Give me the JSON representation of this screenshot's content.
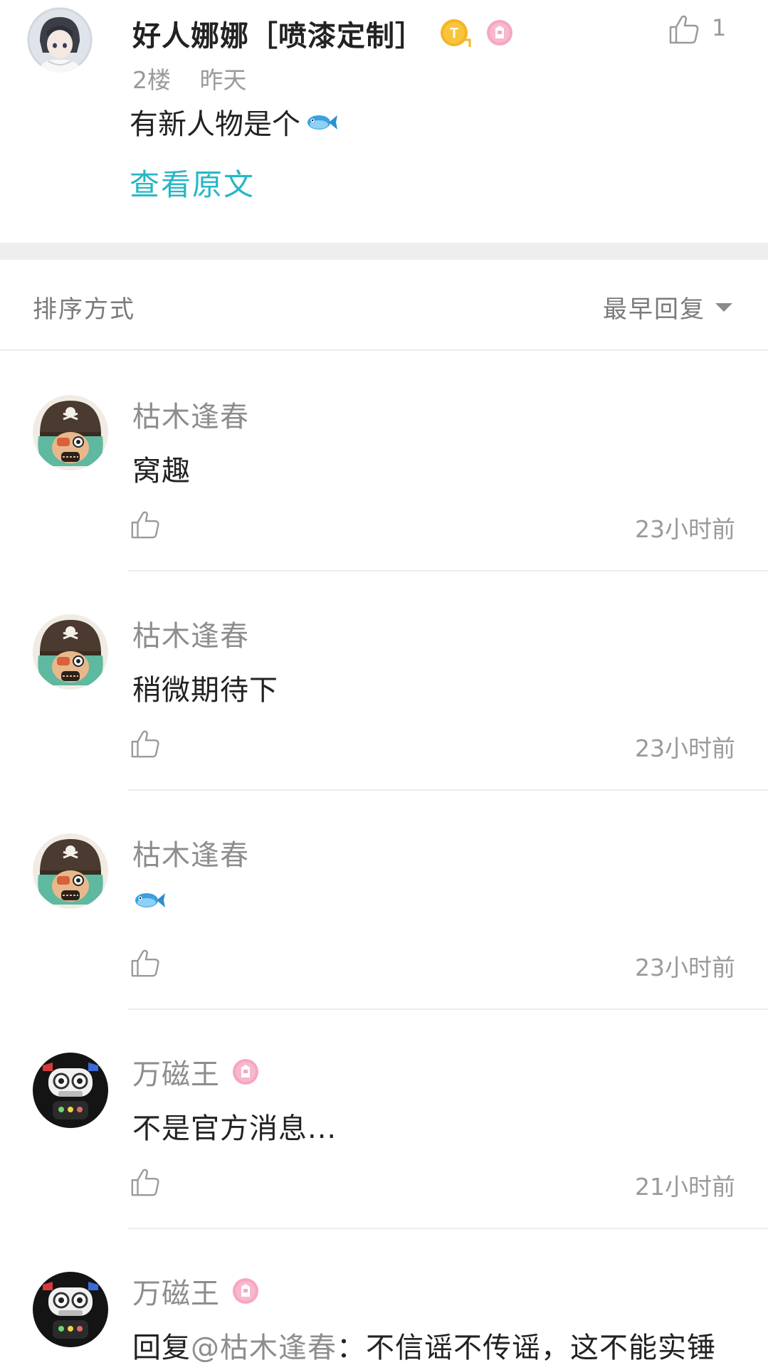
{
  "post": {
    "author": "好人娜娜［喷漆定制］",
    "floor": "2楼",
    "time": "昨天",
    "content": "有新人物是个",
    "content_emoji": "fish-emoji",
    "view_original": "查看原文",
    "like_count": "1"
  },
  "sort": {
    "label": "排序方式",
    "selected": "最早回复"
  },
  "replies": [
    {
      "author": "枯木逢春",
      "has_badge": false,
      "text": "窝趣",
      "time": "23小时前",
      "avatar": "pirate-avatar"
    },
    {
      "author": "枯木逢春",
      "has_badge": false,
      "text": "稍微期待下",
      "time": "23小时前",
      "avatar": "pirate-avatar"
    },
    {
      "author": "枯木逢春",
      "has_badge": false,
      "text": "",
      "emoji": "fish-emoji",
      "time": "23小时前",
      "avatar": "pirate-avatar"
    },
    {
      "author": "万磁王",
      "has_badge": true,
      "text": "不是官方消息...",
      "time": "21小时前",
      "avatar": "robot-avatar"
    },
    {
      "author": "万磁王",
      "has_badge": true,
      "reply_prefix": "回复",
      "mention": "@枯木逢春",
      "text": "：不信谣不传谣，这不能实锤",
      "avatar": "robot-avatar"
    }
  ],
  "colors": {
    "accent": "#25b7c6",
    "secondary_text": "#9a9a9a",
    "divider": "#ececec",
    "section_gap": "#eeeeee"
  }
}
